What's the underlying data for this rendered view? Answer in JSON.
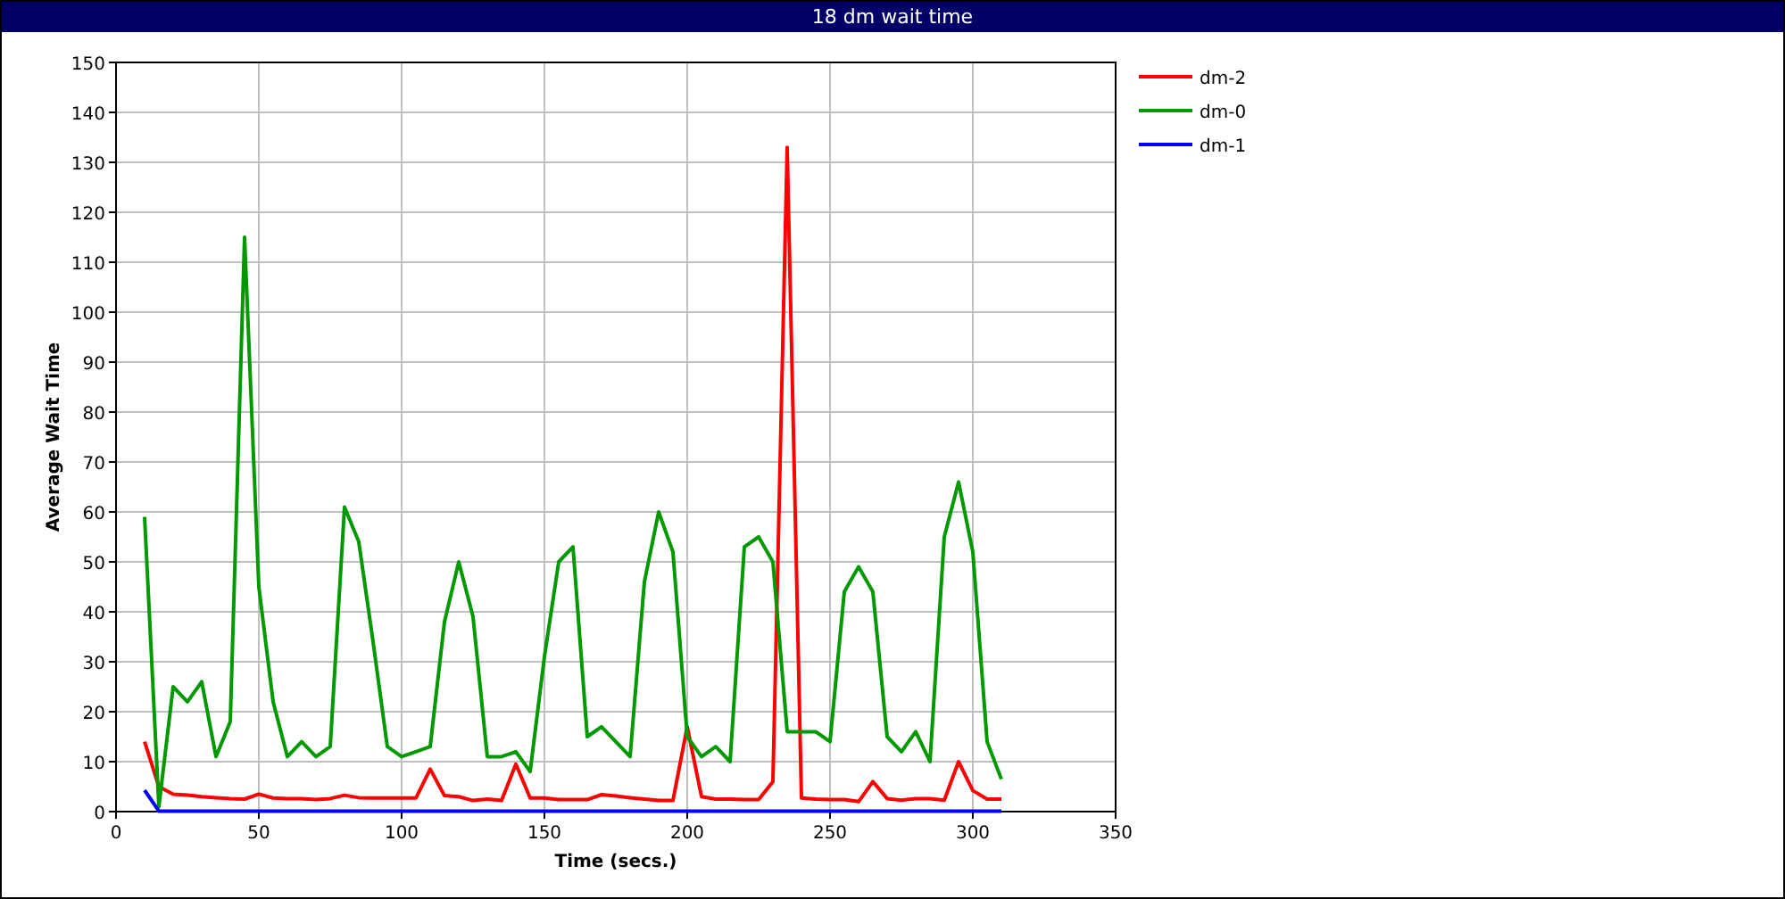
{
  "window": {
    "title": "18 dm wait time"
  },
  "chart": {
    "chart_data": {
      "type": "line",
      "xlabel": "Time (secs.)",
      "ylabel": "Average Wait Time",
      "grid": true,
      "legend": true,
      "xlim": [
        0,
        350
      ],
      "ylim": [
        0,
        150
      ],
      "xticks": [
        0,
        50,
        100,
        150,
        200,
        250,
        300,
        350
      ],
      "yticks": [
        0,
        10,
        20,
        30,
        40,
        50,
        60,
        70,
        80,
        90,
        100,
        110,
        120,
        130,
        140,
        150
      ],
      "x": [
        10,
        15,
        20,
        25,
        30,
        35,
        40,
        45,
        50,
        55,
        60,
        65,
        70,
        75,
        80,
        85,
        90,
        95,
        100,
        105,
        110,
        115,
        120,
        125,
        130,
        135,
        140,
        145,
        150,
        155,
        160,
        165,
        170,
        175,
        180,
        185,
        190,
        195,
        200,
        205,
        210,
        215,
        220,
        225,
        230,
        235,
        240,
        245,
        250,
        255,
        260,
        265,
        270,
        275,
        280,
        285,
        290,
        295,
        300,
        305,
        310
      ],
      "series": [
        {
          "name": "dm-2",
          "color": "#ff0000",
          "values": [
            14,
            5,
            3.5,
            3.3,
            3,
            2.8,
            2.6,
            2.5,
            3.5,
            2.7,
            2.6,
            2.6,
            2.4,
            2.6,
            3.3,
            2.8,
            2.7,
            2.7,
            2.7,
            2.7,
            8.5,
            3.2,
            3,
            2.2,
            2.5,
            2.2,
            9.5,
            2.7,
            2.7,
            2.4,
            2.4,
            2.4,
            3.4,
            3.1,
            2.8,
            2.5,
            2.2,
            2.2,
            17,
            3,
            2.5,
            2.5,
            2.4,
            2.4,
            6,
            133,
            2.7,
            2.5,
            2.4,
            2.4,
            2,
            6,
            2.6,
            2.3,
            2.6,
            2.6,
            2.3,
            10,
            4.2,
            2.5,
            2.5
          ]
        },
        {
          "name": "dm-0",
          "color": "#009900",
          "values": [
            59,
            1,
            25,
            22,
            26,
            11,
            18,
            115,
            45,
            22,
            11,
            14,
            11,
            13,
            61,
            54,
            34,
            13,
            11,
            12,
            13,
            38,
            50,
            39,
            11,
            11,
            12,
            8,
            31,
            50,
            53,
            15,
            17,
            14,
            11,
            46,
            60,
            52,
            15,
            11,
            13,
            10,
            53,
            55,
            50,
            16,
            16,
            16,
            14,
            44,
            49,
            44,
            15,
            12,
            16,
            10,
            55,
            66,
            52,
            14,
            6.5
          ]
        },
        {
          "name": "dm-1",
          "color": "#0000ff",
          "values": [
            4.3,
            0.1,
            0.1,
            0.1,
            0.1,
            0.1,
            0.1,
            0.1,
            0.1,
            0.1,
            0.1,
            0.1,
            0.1,
            0.1,
            0.1,
            0.1,
            0.1,
            0.1,
            0.1,
            0.1,
            0.1,
            0.1,
            0.1,
            0.1,
            0.1,
            0.1,
            0.1,
            0.1,
            0.1,
            0.1,
            0.1,
            0.1,
            0.1,
            0.1,
            0.1,
            0.1,
            0.1,
            0.1,
            0.1,
            0.1,
            0.1,
            0.1,
            0.1,
            0.1,
            0.1,
            0.1,
            0.1,
            0.1,
            0.1,
            0.1,
            0.1,
            0.1,
            0.1,
            0.1,
            0.1,
            0.1,
            0.1,
            0.1,
            0.1,
            0.1,
            0.1
          ]
        }
      ]
    }
  }
}
